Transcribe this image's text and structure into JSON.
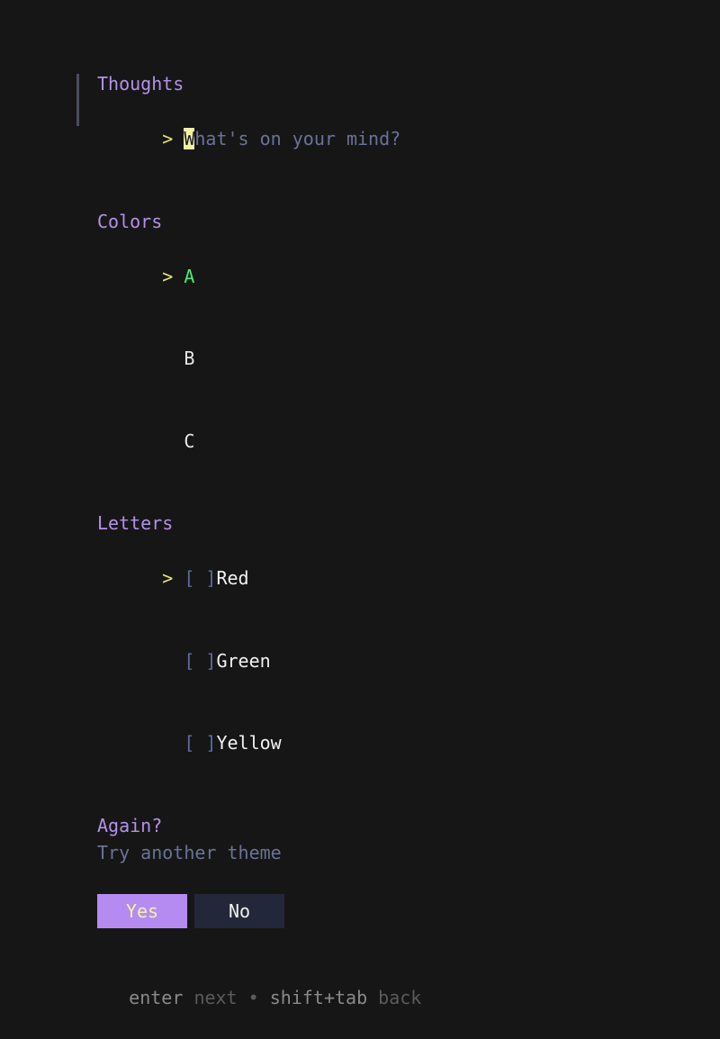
{
  "theme": {
    "background": "#161616",
    "heading": "#b491e8",
    "marker": "#e6e67c",
    "cursor_bg": "#f2f2a5",
    "placeholder": "#6b7298",
    "selected_option": "#45ef76",
    "normal_text": "#e9e9e9",
    "checkbox": "#5d6b98",
    "accent_bar": "#4a4e5e",
    "button_active_bg": "#b58bf2",
    "button_active_fg": "#f2f2a8",
    "button_inactive_bg": "#23273a",
    "button_inactive_fg": "#f0f0f0",
    "help_key": "#8a8a8a",
    "help_desc": "#5b5b5b"
  },
  "text_prompt": {
    "heading": "Thoughts",
    "marker": ">",
    "cursor_char": "W",
    "placeholder_rest": "hat's on your mind?",
    "placeholder_full": "What's on your mind?",
    "value": ""
  },
  "select_prompt": {
    "heading": "Colors",
    "marker": ">",
    "selected_index": 0,
    "options": [
      {
        "label": "A",
        "selected": true
      },
      {
        "label": "B",
        "selected": false
      },
      {
        "label": "C",
        "selected": false
      }
    ]
  },
  "multiselect_prompt": {
    "heading": "Letters",
    "marker": ">",
    "cursor_index": 0,
    "checkbox_unchecked": "[ ]",
    "checkbox_checked": "[x]",
    "options": [
      {
        "label": "Red",
        "checked": false,
        "box": "[ ]"
      },
      {
        "label": "Green",
        "checked": false,
        "box": "[ ]"
      },
      {
        "label": "Yellow",
        "checked": false,
        "box": "[ ]"
      }
    ]
  },
  "confirm_prompt": {
    "heading": "Again?",
    "subtitle": "Try another theme",
    "yes_label": "Yes",
    "no_label": "No",
    "focused": "yes"
  },
  "footer": {
    "key_1": "enter",
    "desc_1": "next",
    "separator": "•",
    "key_2": "shift+tab",
    "desc_2": "back"
  }
}
